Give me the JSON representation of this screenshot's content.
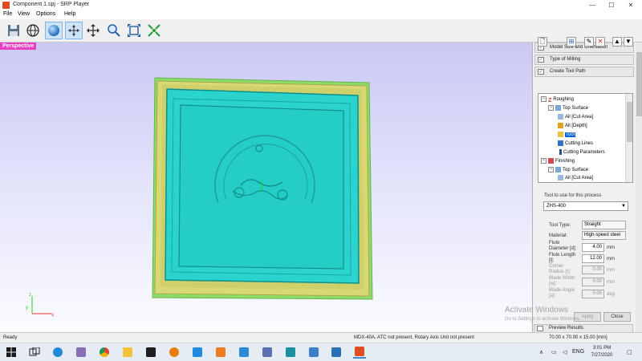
{
  "window": {
    "title": "Component 1.spj - SRP Player",
    "minimize_glyph": "—",
    "maximize_glyph": "☐",
    "close_glyph": "✕"
  },
  "menu": [
    "File",
    "View",
    "Options",
    "Help"
  ],
  "toolbar": {
    "icons": [
      "save-icon",
      "globe-icon",
      "sphere-icon",
      "move-axes-icon",
      "pan-icon",
      "zoom-icon",
      "fit-view-icon",
      "select-icon"
    ],
    "active": [
      "sphere-icon",
      "move-axes-icon"
    ]
  },
  "viewport": {
    "label": "Perspective",
    "label_color": "#e83fc5",
    "model_color_top": "#2ad3cd",
    "model_color_frame": "#d5d56e",
    "model_color_edge": "#8ddc6a"
  },
  "panel": {
    "steps": [
      {
        "label": "Model Size and Orientation",
        "checked": true
      },
      {
        "label": "Type of Milling",
        "checked": true
      },
      {
        "label": "Create Tool Path",
        "checked": true
      }
    ],
    "tree": [
      {
        "indent": 0,
        "expander": "−",
        "label": "Roughing",
        "icon": "roughing-icon"
      },
      {
        "indent": 1,
        "expander": "−",
        "label": "Top Surface",
        "icon": "surface-icon"
      },
      {
        "indent": 2,
        "expander": "",
        "label": "All [Cut Area]",
        "icon": "area-icon"
      },
      {
        "indent": 2,
        "expander": "",
        "label": "All [Depth]",
        "icon": "depth-icon"
      },
      {
        "indent": 2,
        "expander": "",
        "label": "Tool",
        "icon": "tool-icon",
        "selected": true
      },
      {
        "indent": 2,
        "expander": "",
        "label": "Cutting Lines",
        "icon": "lines-icon"
      },
      {
        "indent": 2,
        "expander": "",
        "label": "Cutting Parameters",
        "icon": "params-icon"
      },
      {
        "indent": 0,
        "expander": "−",
        "label": "Finishing",
        "icon": "finishing-icon"
      },
      {
        "indent": 1,
        "expander": "−",
        "label": "Top Surface",
        "icon": "surface-icon"
      },
      {
        "indent": 2,
        "expander": "",
        "label": "All [Cut Area]",
        "icon": "area-icon"
      }
    ],
    "tool_section_label": "Tool to use for this process",
    "tool_selected": "ZHS-400",
    "fields": {
      "tool_type_label": "Tool Type:",
      "tool_type_value": "Straight",
      "material_label": "Material:",
      "material_value": "High-speed steel",
      "flute_diameter_label": "Flute Diameter [d]:",
      "flute_diameter_value": "4.00",
      "flute_length_label": "Flute Length [l]:",
      "flute_length_value": "12.00",
      "corner_radius_label": "Corner Radius [r]:",
      "corner_radius_value": "0.00",
      "blade_width_label": "Blade Width [w]:",
      "blade_width_value": "0.00",
      "blade_angle_label": "Blade Angle [a]:",
      "blade_angle_value": "0.00",
      "unit_mm": "mm",
      "unit_deg": "deg"
    },
    "apply_label": "Apply",
    "close_label": "Close",
    "preview_results_label": "Preview Results"
  },
  "watermark": {
    "line1": "Activate Windows",
    "line2": "Go to Settings to activate Windows."
  },
  "status": {
    "left": "Ready",
    "middle": "MDX-40A, ATC not present, Rotary Axis Unit not present",
    "right": "70.00 x 70.00 x 15.00 [mm]"
  },
  "taskbar": {
    "lang": "ENG",
    "time": "3:01 PM",
    "date": "7/27/2020",
    "chevron": "∧"
  }
}
